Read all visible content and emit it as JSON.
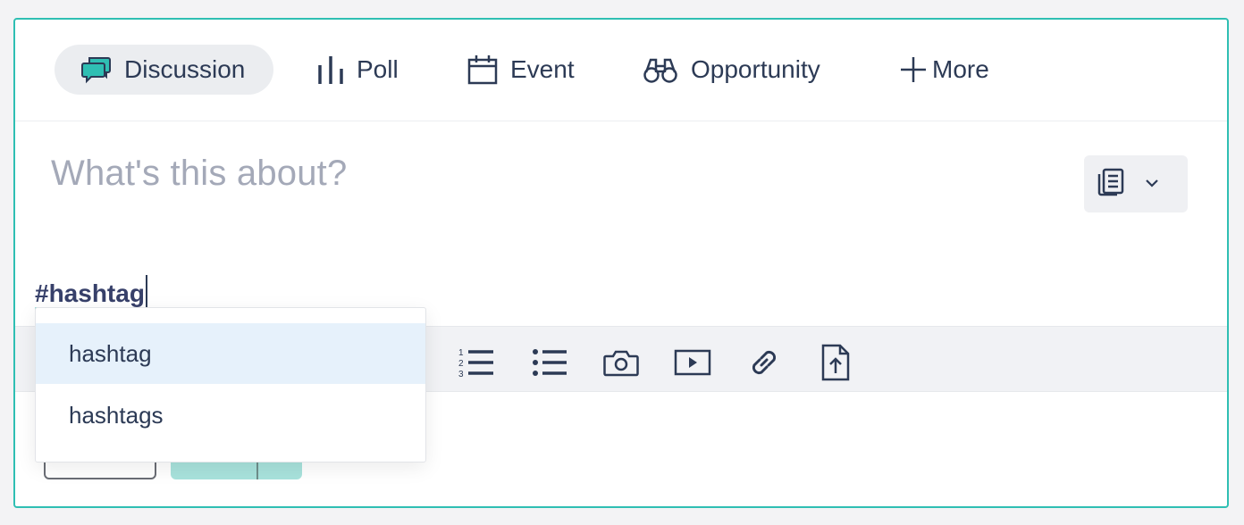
{
  "tabs": [
    {
      "label": "Discussion",
      "icon": "chat-bubbles-icon",
      "active": true
    },
    {
      "label": "Poll",
      "icon": "bar-chart-icon"
    },
    {
      "label": "Event",
      "icon": "calendar-icon"
    },
    {
      "label": "Opportunity",
      "icon": "binoculars-icon"
    },
    {
      "label": "More",
      "icon": "plus-icon"
    }
  ],
  "editor": {
    "title_placeholder": "What's this about?",
    "body_text": "#hashtag",
    "type_select_icon": "document-icon"
  },
  "toolbar": {
    "tools": [
      "numbered-list-icon",
      "bullet-list-icon",
      "camera-icon",
      "video-icon",
      "link-icon",
      "file-upload-icon"
    ]
  },
  "suggestions": [
    "hashtag",
    "hashtags"
  ],
  "colors": {
    "accent": "#2fbfb3",
    "highlight": "#e6f1fb",
    "text": "#2c3a55",
    "placeholder": "#a4a9b8"
  }
}
